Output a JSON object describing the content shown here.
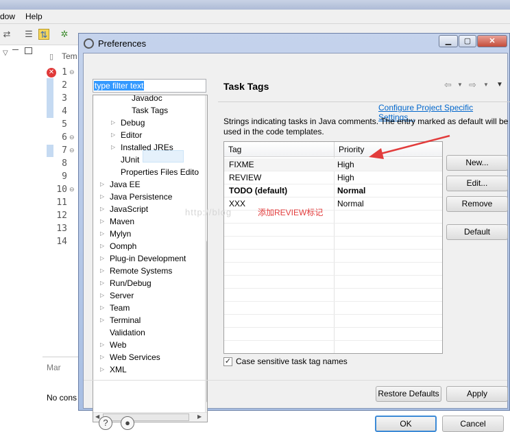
{
  "ide": {
    "menu": [
      "dow",
      "Help"
    ],
    "line_numbers": [
      "1",
      "2",
      "3",
      "4",
      "5",
      "6",
      "7",
      "8",
      "9",
      "10",
      "11",
      "12",
      "13",
      "14"
    ],
    "tab_label": "Tem",
    "bottom_tab_label": "Mar",
    "bottom_text": "No cons"
  },
  "dialog": {
    "title": "Preferences",
    "window_buttons": [
      "minimize-icon",
      "maximize-icon",
      "close-icon"
    ],
    "filter_placeholder": "type filter text",
    "tree": [
      {
        "label": "Javadoc",
        "indent": 3,
        "arrow": false
      },
      {
        "label": "Task Tags",
        "indent": 3,
        "arrow": false,
        "selected": true
      },
      {
        "label": "Debug",
        "indent": 2,
        "arrow": true
      },
      {
        "label": "Editor",
        "indent": 2,
        "arrow": true
      },
      {
        "label": "Installed JREs",
        "indent": 2,
        "arrow": true
      },
      {
        "label": "JUnit",
        "indent": 2,
        "arrow": false
      },
      {
        "label": "Properties Files Edito",
        "indent": 2,
        "arrow": false
      },
      {
        "label": "Java EE",
        "indent": 1,
        "arrow": true
      },
      {
        "label": "Java Persistence",
        "indent": 1,
        "arrow": true
      },
      {
        "label": "JavaScript",
        "indent": 1,
        "arrow": true
      },
      {
        "label": "Maven",
        "indent": 1,
        "arrow": true
      },
      {
        "label": "Mylyn",
        "indent": 1,
        "arrow": true
      },
      {
        "label": "Oomph",
        "indent": 1,
        "arrow": true
      },
      {
        "label": "Plug-in Development",
        "indent": 1,
        "arrow": true
      },
      {
        "label": "Remote Systems",
        "indent": 1,
        "arrow": true
      },
      {
        "label": "Run/Debug",
        "indent": 1,
        "arrow": true
      },
      {
        "label": "Server",
        "indent": 1,
        "arrow": true
      },
      {
        "label": "Team",
        "indent": 1,
        "arrow": true
      },
      {
        "label": "Terminal",
        "indent": 1,
        "arrow": true
      },
      {
        "label": "Validation",
        "indent": 1,
        "arrow": false
      },
      {
        "label": "Web",
        "indent": 1,
        "arrow": true
      },
      {
        "label": "Web Services",
        "indent": 1,
        "arrow": true
      },
      {
        "label": "XML",
        "indent": 1,
        "arrow": true
      }
    ],
    "page": {
      "title": "Task Tags",
      "configure_link": "Configure Project Specific Settings...",
      "description": "Strings indicating tasks in Java comments. The entry marked as default will be used in the code templates.",
      "columns": [
        "Tag",
        "Priority"
      ],
      "rows": [
        {
          "tag": "FIXME",
          "priority": "High",
          "bold": false
        },
        {
          "tag": "REVIEW",
          "priority": "High",
          "bold": false
        },
        {
          "tag": "TODO (default)",
          "priority": "Normal",
          "bold": true
        },
        {
          "tag": "XXX",
          "priority": "Normal",
          "bold": false
        }
      ],
      "buttons": {
        "new": "New...",
        "edit": "Edit...",
        "remove": "Remove",
        "default": "Default"
      },
      "case_sensitive_label": "Case sensitive task tag names",
      "case_sensitive_checked": true,
      "restore_defaults": "Restore Defaults",
      "apply": "Apply"
    },
    "footer": {
      "ok": "OK",
      "cancel": "Cancel"
    },
    "annotation": "添加REVIEW标记",
    "watermark": "http://blog",
    "colors": {
      "accent": "#3399ff",
      "link": "#0066cc",
      "annotation": "#e23c3c",
      "title_bar": "#b7c8e8"
    }
  }
}
